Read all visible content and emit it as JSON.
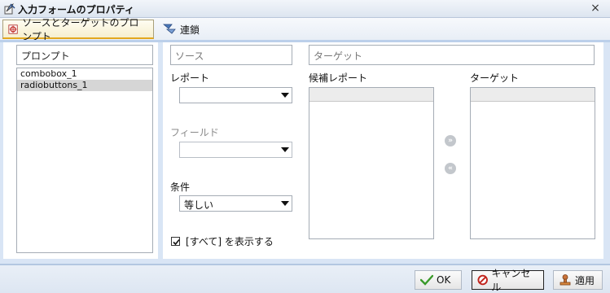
{
  "window": {
    "title": "入力フォームのプロパティ",
    "close_glyph": "×"
  },
  "tabs": [
    {
      "label": "ソースとターゲットのプロンプト",
      "icon": "target-prompt-icon",
      "active": true
    },
    {
      "label": "連鎖",
      "icon": "chain-icon",
      "active": false
    }
  ],
  "prompt_panel": {
    "header": "プロンプト",
    "items": [
      {
        "label": "combobox_1",
        "selected": false
      },
      {
        "label": "radiobuttons_1",
        "selected": true
      }
    ]
  },
  "source": {
    "header": "ソース",
    "report_label": "レポート",
    "report_value": "",
    "field_label": "フィールド",
    "field_value": "",
    "condition_label": "条件",
    "condition_value": "等しい",
    "show_all_label": "[すべて] を表示する",
    "show_all_checked": true
  },
  "target": {
    "header": "ターゲット",
    "candidate_reports_label": "候補レポート",
    "target_label": "ターゲット",
    "add_glyph": "»",
    "remove_glyph": "«"
  },
  "footer": {
    "ok_label": "OK",
    "cancel_label": "キャンセル",
    "apply_label": "適用"
  },
  "colors": {
    "panel_background": "#d9e5f5",
    "active_tab_underline": "#e3a81f",
    "ok_check": "#3a9a2a",
    "cancel_icon": "#c0241c"
  }
}
